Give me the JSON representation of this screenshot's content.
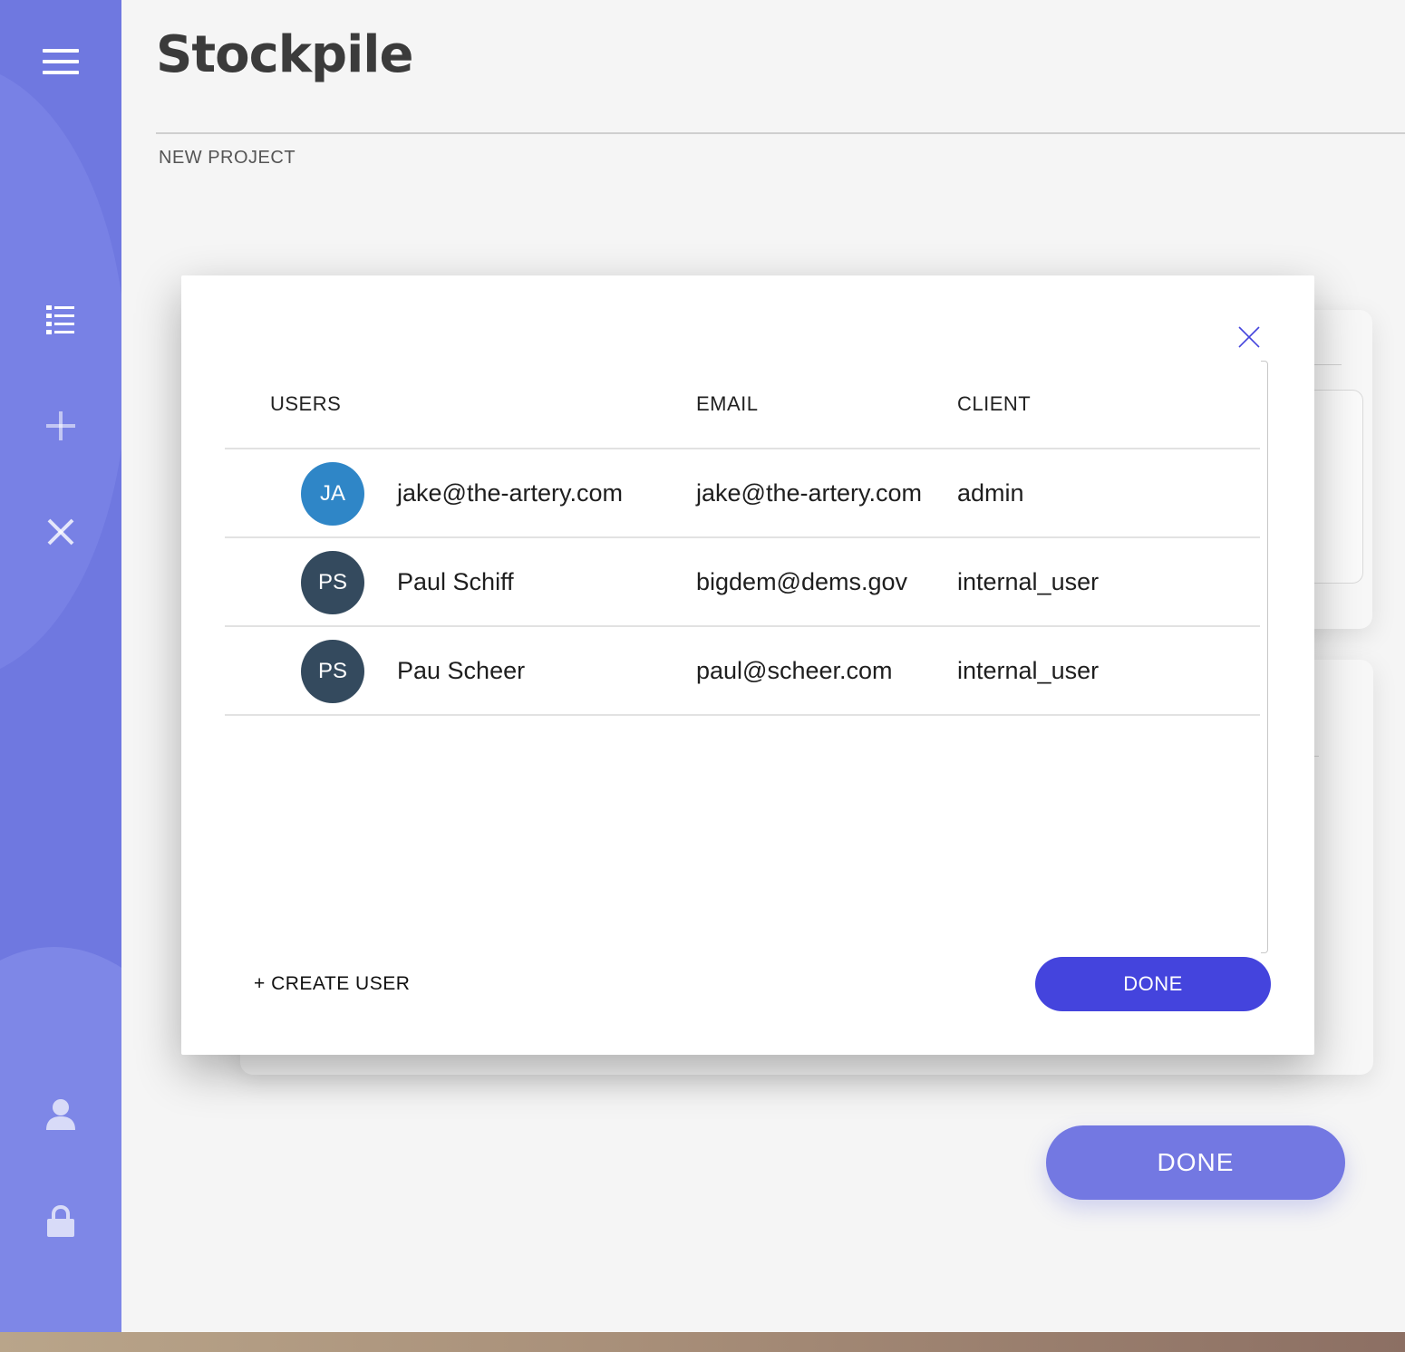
{
  "app": {
    "title": "Stockpile",
    "breadcrumb": "NEW PROJECT",
    "background_done_label": "DONE"
  },
  "sidebar": {
    "icons": [
      "menu-icon",
      "list-icon",
      "plus-icon",
      "close-icon",
      "user-icon",
      "lock-icon"
    ],
    "color": "#6f78e0"
  },
  "modal": {
    "columns": {
      "users": "USERS",
      "email": "EMAIL",
      "client": "CLIENT"
    },
    "rows": [
      {
        "initials": "JA",
        "name": "jake@the-artery.com",
        "email": "jake@the-artery.com",
        "client": "admin",
        "avatar_color": "#2f86c7"
      },
      {
        "initials": "PS",
        "name": "Paul Schiff",
        "email": "bigdem@dems.gov",
        "client": "internal_user",
        "avatar_color": "#344a5e"
      },
      {
        "initials": "PS",
        "name": "Pau Scheer",
        "email": "paul@scheer.com",
        "client": "internal_user",
        "avatar_color": "#344a5e"
      }
    ],
    "create_user_label": "+ CREATE USER",
    "done_label": "DONE",
    "accent_color": "#4444dd"
  }
}
